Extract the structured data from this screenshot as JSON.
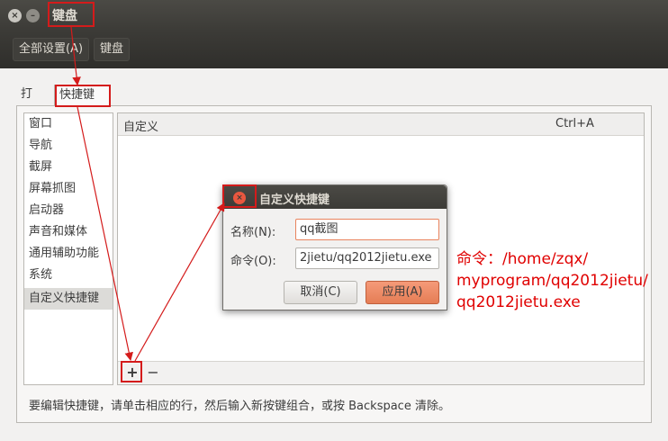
{
  "window": {
    "title": "键盘",
    "close_glyph": "×",
    "min_glyph": "–"
  },
  "breadcrumb": {
    "all_settings": "全部设置(A)",
    "current": "键盘"
  },
  "tabs": [
    {
      "label": "打字"
    },
    {
      "label": "快捷键"
    }
  ],
  "categories": [
    {
      "label": "窗口"
    },
    {
      "label": "导航"
    },
    {
      "label": "截屏"
    },
    {
      "label": "屏幕抓图"
    },
    {
      "label": "启动器"
    },
    {
      "label": "声音和媒体"
    },
    {
      "label": "通用辅助功能"
    },
    {
      "label": "系统"
    },
    {
      "label": "自定义快捷键",
      "selected": true
    }
  ],
  "shortcuts_table": {
    "col_name": "自定义",
    "col_accel": "Ctrl+A"
  },
  "toolbar": {
    "add": "+",
    "remove": "−"
  },
  "hint": "要编辑快捷键，请单击相应的行，然后输入新按键组合，或按 Backspace 清除。",
  "dialog": {
    "title": "自定义快捷键",
    "close_glyph": "×",
    "name_label": "名称(N):",
    "name_value": "qq截图",
    "command_label": "命令(O):",
    "command_value": "2jietu/qq2012jietu.exe",
    "cancel": "取消(C)",
    "apply": "应用(A)"
  },
  "annotation": {
    "lines": [
      "命令：/home/zqx/",
      "myprogram/qq2012jietu/",
      "qq2012jietu.exe"
    ],
    "color": "#e00000"
  },
  "colors": {
    "accent": "#e57d55",
    "titlebar": "#3c3b37",
    "annotation": "#d41b1b"
  }
}
